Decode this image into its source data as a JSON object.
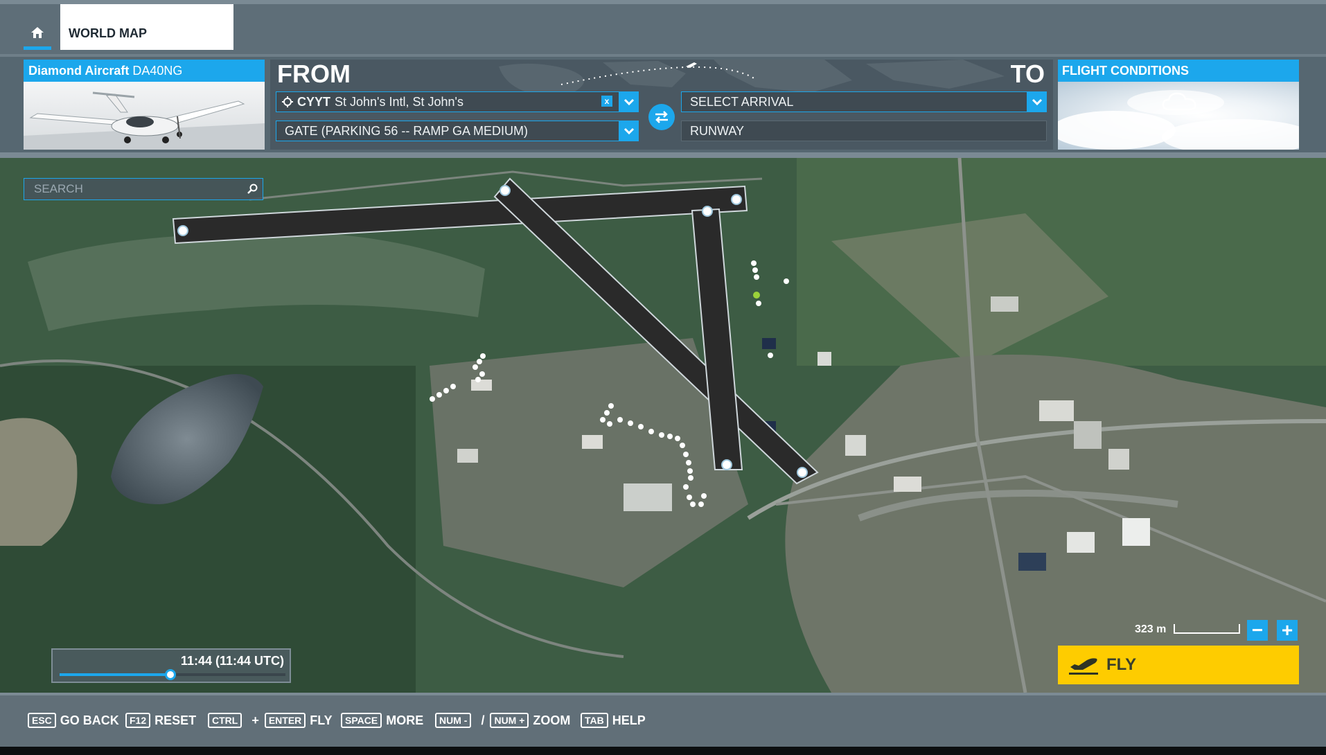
{
  "tabs": {
    "home_icon": "home-icon",
    "world_map": "WORLD MAP"
  },
  "aircraft": {
    "make": "Diamond Aircraft",
    "model": "DA40NG"
  },
  "route": {
    "from_label": "FROM",
    "to_label": "TO",
    "departure_code": "CYYT",
    "departure_name": "St John's Intl, St John's",
    "clear_label": "x",
    "gate": "GATE (PARKING 56 -- RAMP GA MEDIUM)",
    "arrival_placeholder": "SELECT ARRIVAL",
    "arrival_runway": "RUNWAY"
  },
  "conditions": {
    "title": "FLIGHT CONDITIONS"
  },
  "map": {
    "search_placeholder": "SEARCH",
    "time_label": "11:44 (11:44 UTC)",
    "time_progress": 0.49,
    "scale_label": "323 m",
    "zoom_out": "−",
    "zoom_in": "+"
  },
  "fly": {
    "label": "FLY"
  },
  "footer": {
    "hints": [
      {
        "keys": [
          "ESC"
        ],
        "label": "GO BACK"
      },
      {
        "keys": [
          "F12"
        ],
        "label": "RESET"
      },
      {
        "keys": [
          "CTRL",
          "ENTER"
        ],
        "join": "+",
        "label": "FLY"
      },
      {
        "keys": [
          "SPACE"
        ],
        "label": "MORE"
      },
      {
        "keys": [
          "NUM -",
          "NUM +"
        ],
        "join": "/",
        "label": "ZOOM"
      },
      {
        "keys": [
          "TAB"
        ],
        "label": "HELP"
      }
    ]
  },
  "colors": {
    "accent": "#1ca7ec",
    "fly": "#fecc00",
    "runway": "#2a2a2a"
  }
}
